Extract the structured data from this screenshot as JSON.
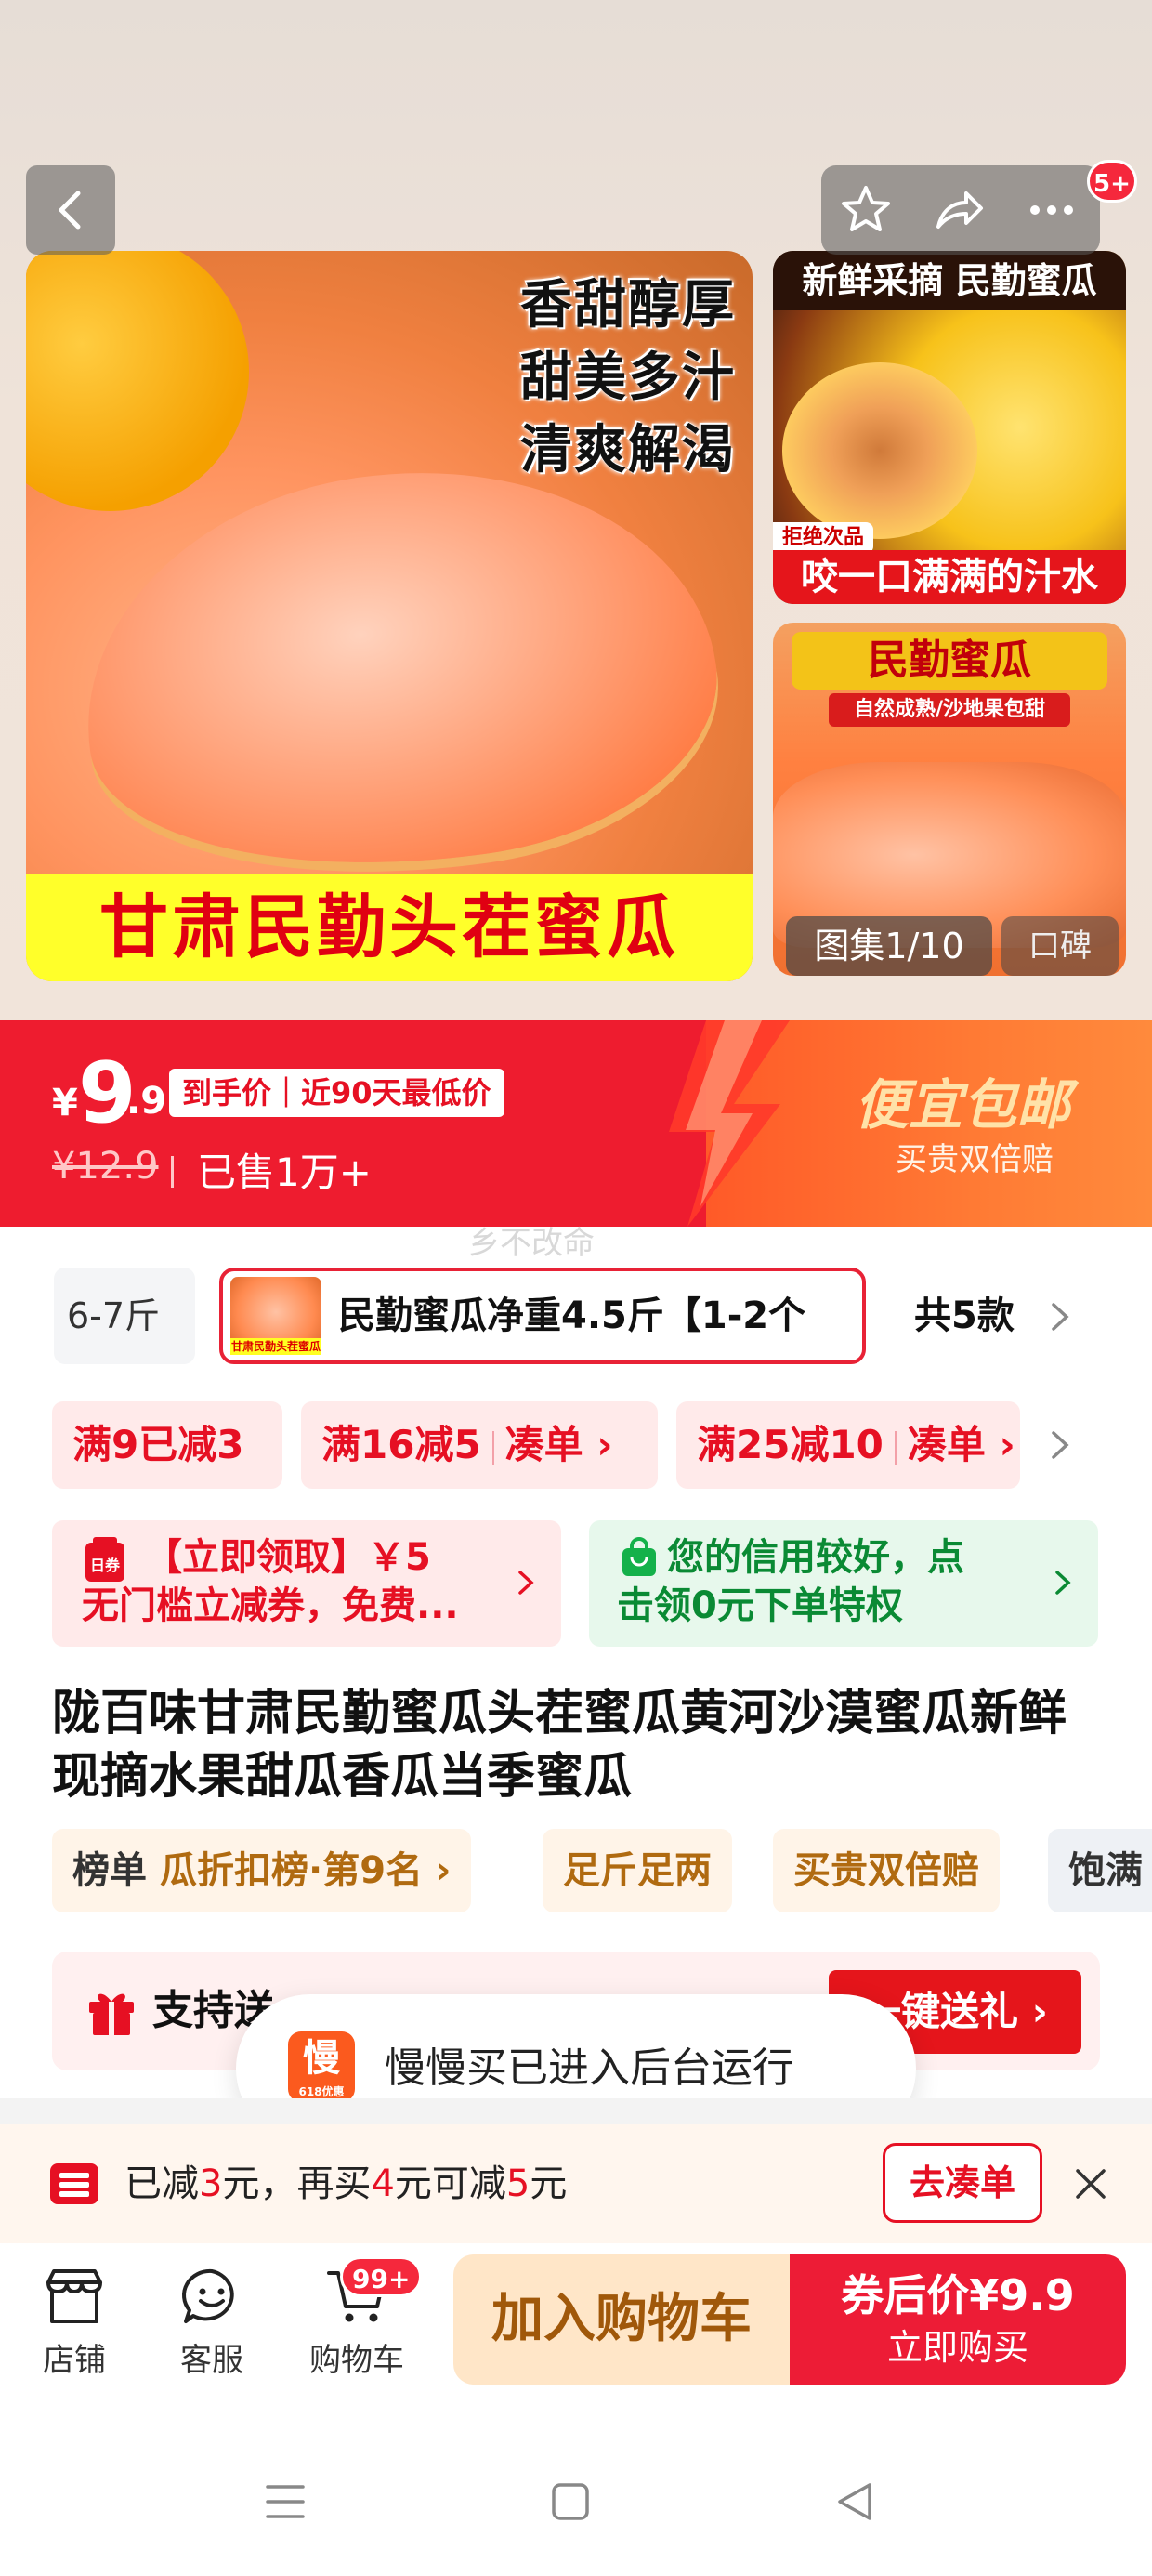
{
  "gallery": {
    "main_slogans": [
      "香甜醇厚",
      "甜美多汁",
      "清爽解渴"
    ],
    "main_banner": "甘肃民勤头茬蜜瓜",
    "side1_title": "新鲜采摘 民勤蜜瓜",
    "side1_tag": "拒绝次品",
    "side1_bottom": "咬一口满满的汁水",
    "side2_title": "民勤蜜瓜",
    "side2_sub": "自然成熟/沙地果包甜",
    "counter": "图集1/10",
    "koubei": "口碑",
    "notification_badge": "5+"
  },
  "price": {
    "symbol": "¥",
    "integer": "9",
    "decimal": ".9",
    "tag": "到手价｜近90天最低价",
    "original": "¥12.9",
    "sold": "已售1万+",
    "free_shipping": "便宜包邮",
    "double_comp": "买贵双倍赔"
  },
  "watermark": "乡不改命",
  "sku": {
    "prev": "6-7斤",
    "selected": "民勤蜜瓜净重4.5斤【1-2个",
    "thumb_caption": "甘肃民勤头茬蜜瓜",
    "count": "共5款"
  },
  "coupons": [
    {
      "text": "满9已减3"
    },
    {
      "text": "满16减5",
      "action": "凑单 ›"
    },
    {
      "text": "满25减10",
      "action": "凑单 ›"
    }
  ],
  "cards": {
    "red_line1": "【立即领取】￥5",
    "red_line2": "无门槛立减券，免费...",
    "red_icon_label": "日券",
    "green_line1": "您的信用较好，点",
    "green_line2": "击领0元下单特权"
  },
  "product": {
    "title": "陇百味甘肃民勤蜜瓜头茬蜜瓜黄河沙漠蜜瓜新鲜现摘水果甜瓜香瓜当季蜜瓜"
  },
  "tags": {
    "rank_prefix": "榜单",
    "rank": "瓜折扣榜·第9名 ›",
    "t2": "足斤足两",
    "t3": "买贵双倍赔",
    "t4": "饱满"
  },
  "gift": {
    "text": "支持送",
    "button": "一键送礼 ›"
  },
  "toast": {
    "icon_char": "慢",
    "icon_sub": "618优惠",
    "text": "慢慢买已进入后台运行"
  },
  "promo": {
    "p1": "已减",
    "n1": "3",
    "p2": "元，再买",
    "n2": "4",
    "p3": "元可减",
    "n3": "5",
    "p4": "元",
    "button": "去凑单"
  },
  "bottom": {
    "store": "店铺",
    "service": "客服",
    "cart": "购物车",
    "cart_badge": "99+",
    "add_to_cart": "加入购物车",
    "buy_line1": "券后价¥9.9",
    "buy_line2": "立即购买"
  },
  "colors": {
    "primary_red": "#ee1c2f",
    "accent_orange": "#ff7a34",
    "light_red_bg": "#ffeaea",
    "green": "#0a8a34"
  }
}
